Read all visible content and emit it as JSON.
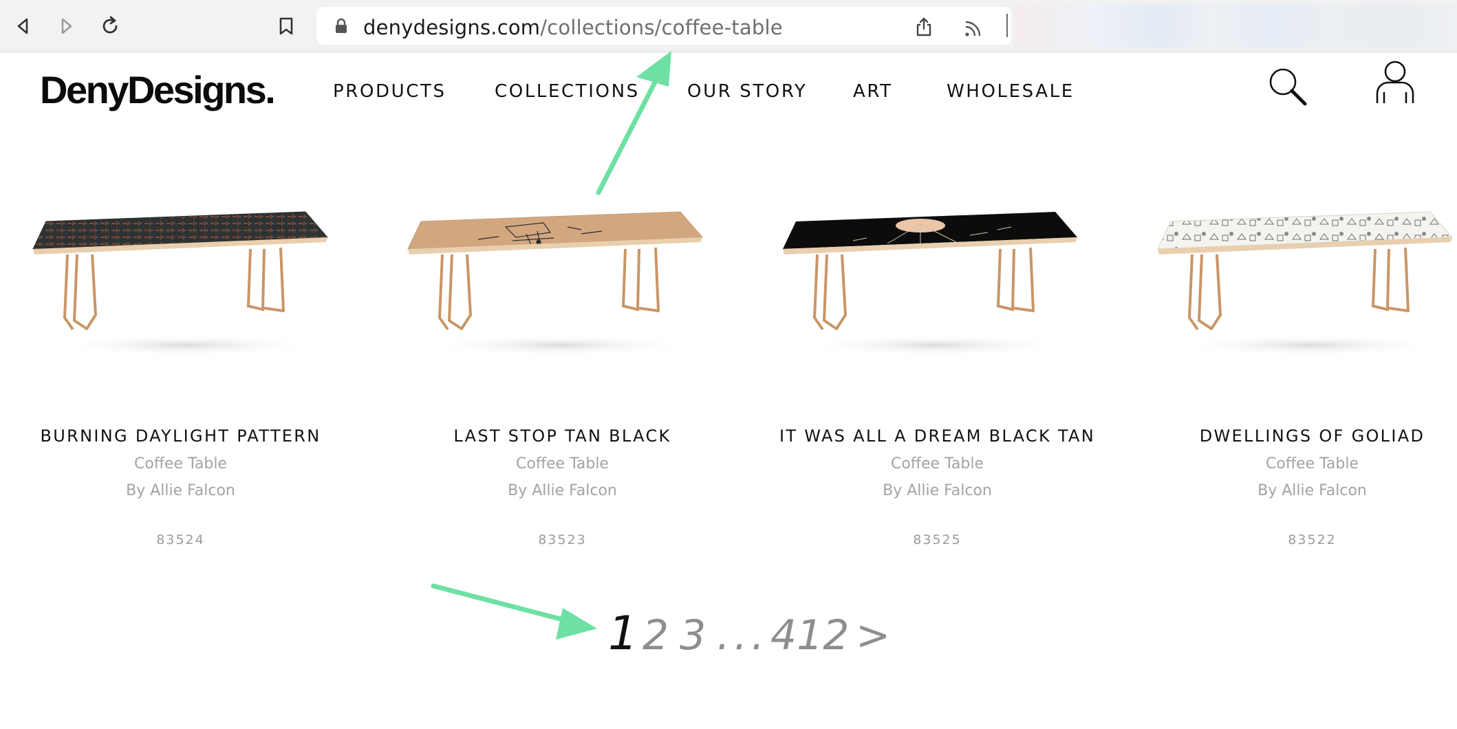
{
  "browser": {
    "url_domain": "denydesigns.com",
    "url_path": "/collections/coffee-table",
    "back_icon": "chevron-left-icon",
    "forward_icon": "chevron-right-icon",
    "reload_icon": "reload-icon",
    "bookmark_icon": "bookmark-icon",
    "lock_icon": "lock-icon",
    "share_icon": "share-icon",
    "cast_icon": "cast-icon"
  },
  "site": {
    "logo": "DenyDesigns.",
    "nav": [
      "PRODUCTS",
      "COLLECTIONS",
      "OUR STORY",
      "ART",
      "WHOLESALE"
    ],
    "search_icon": "search-icon",
    "account_icon": "user-icon"
  },
  "products": [
    {
      "title": "BURNING DAYLIGHT PATTERN",
      "type": "Coffee Table",
      "artist": "By Allie Falcon",
      "sku": "83524",
      "top_color": "#2f3232",
      "pattern": "grid"
    },
    {
      "title": "LAST STOP TAN BLACK",
      "type": "Coffee Table",
      "artist": "By Allie Falcon",
      "sku": "83523",
      "top_color": "#d2a780",
      "pattern": "sketch"
    },
    {
      "title": "IT WAS ALL A DREAM BLACK TAN",
      "type": "Coffee Table",
      "artist": "By Allie Falcon",
      "sku": "83525",
      "top_color": "#0c0c0c",
      "pattern": "moon"
    },
    {
      "title": "DWELLINGS OF GOLIAD",
      "type": "Coffee Table",
      "artist": "By Allie Falcon",
      "sku": "83522",
      "top_color": "#f4f3ee",
      "pattern": "toile"
    }
  ],
  "pagination": {
    "current": "1",
    "pages": [
      "2",
      "3"
    ],
    "ellipsis": "...",
    "last": "412",
    "next": ">"
  },
  "colors": {
    "annotation_arrow": "#6ee0a4",
    "table_edge": "#e8cfae",
    "table_legs": "#c99667"
  }
}
